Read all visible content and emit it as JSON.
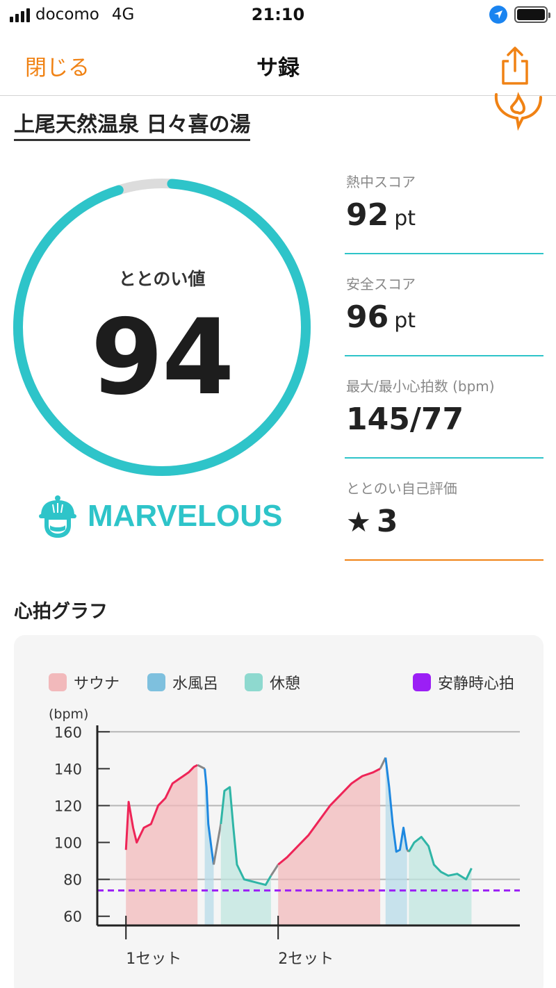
{
  "status_bar": {
    "carrier": "docomo",
    "network": "4G",
    "time": "21:10"
  },
  "nav": {
    "close_label": "閉じる",
    "title": "サ録"
  },
  "facility": {
    "name": "上尾天然温泉 日々喜の湯"
  },
  "totonoi": {
    "label": "ととのい値",
    "value": "94",
    "progress_percent": 94,
    "rank": "MARVELOUS"
  },
  "metrics": [
    {
      "label": "熱中スコア",
      "value": "92",
      "unit": "pt"
    },
    {
      "label": "安全スコア",
      "value": "96",
      "unit": "pt"
    },
    {
      "label": "最大/最小心拍数 (bpm)",
      "value": "145/77"
    },
    {
      "label": "ととのい自己評価",
      "star": "★",
      "value": "3"
    }
  ],
  "graph_section": {
    "title": "心拍グラフ"
  },
  "colors": {
    "accent_orange": "#f08214",
    "teal": "#2ec4c9",
    "sauna": "#ee2457",
    "sauna_fill": "#f2b9bb",
    "cold_bath": "#1e88e0",
    "cold_bath_fill": "#b7dbe8",
    "rest": "#2fb5a6",
    "rest_fill": "#bfe6df",
    "transition": "#888888",
    "resting_hr": "#9b1ff5"
  },
  "icons": [
    "signal-icon",
    "location-arrow-icon",
    "battery-icon",
    "share-icon",
    "flame-logo-icon",
    "sauna-hat-face-icon",
    "star-icon"
  ],
  "chart_data": {
    "type": "line",
    "ylabel": "(bpm)",
    "ylim": [
      55,
      165
    ],
    "yticks": [
      60,
      80,
      100,
      120,
      140,
      160
    ],
    "y_tick_labels": [
      "60",
      "80",
      "100",
      "120",
      "140",
      "160"
    ],
    "x_tick_labels": [
      "1セット",
      "2セット"
    ],
    "x_ticks": [
      0,
      8.5
    ],
    "xlim": [
      -1.6,
      22
    ],
    "resting_hr": 74,
    "legend": [
      {
        "name": "サウナ",
        "color": "#f2b9bb"
      },
      {
        "name": "水風呂",
        "color": "#7ec0de"
      },
      {
        "name": "休憩",
        "color": "#8ed9cf"
      },
      {
        "name": "安静時心拍",
        "color": "#9b1ff5"
      }
    ],
    "series": [
      {
        "name": "サウナ",
        "x": [
          0,
          0.15,
          0.4,
          0.6,
          1.0,
          1.4,
          1.8,
          2.2,
          2.6,
          2.9,
          3.2,
          3.5,
          3.8,
          4.0
        ],
        "y": [
          96,
          122,
          108,
          100,
          108,
          110,
          120,
          124,
          132,
          134,
          136,
          138,
          141,
          142
        ]
      },
      {
        "name": "水風呂",
        "x": [
          4.4,
          4.5,
          4.6,
          4.8,
          4.9
        ],
        "y": [
          140,
          130,
          110,
          95,
          88
        ]
      },
      {
        "name": "休憩",
        "x": [
          5.3,
          5.5,
          5.8,
          6.0,
          6.2,
          6.6,
          7.0,
          7.4,
          7.8,
          8.1
        ],
        "y": [
          110,
          128,
          130,
          108,
          88,
          80,
          79,
          78,
          77,
          82
        ]
      },
      {
        "name": "サウナ",
        "x": [
          8.5,
          9.0,
          9.6,
          10.2,
          10.8,
          11.4,
          12.0,
          12.6,
          13.2,
          13.8,
          14.2
        ],
        "y": [
          88,
          92,
          98,
          104,
          112,
          120,
          126,
          132,
          136,
          138,
          140
        ]
      },
      {
        "name": "水風呂",
        "x": [
          14.5,
          14.7,
          14.9,
          15.1,
          15.3,
          15.5,
          15.7
        ],
        "y": [
          146,
          130,
          110,
          95,
          96,
          108,
          96
        ]
      },
      {
        "name": "休憩",
        "x": [
          15.8,
          16.1,
          16.5,
          16.9,
          17.2,
          17.6,
          18.0,
          18.5,
          19.0,
          19.3
        ],
        "y": [
          95,
          100,
          103,
          98,
          88,
          84,
          82,
          83,
          80,
          86
        ]
      }
    ]
  }
}
